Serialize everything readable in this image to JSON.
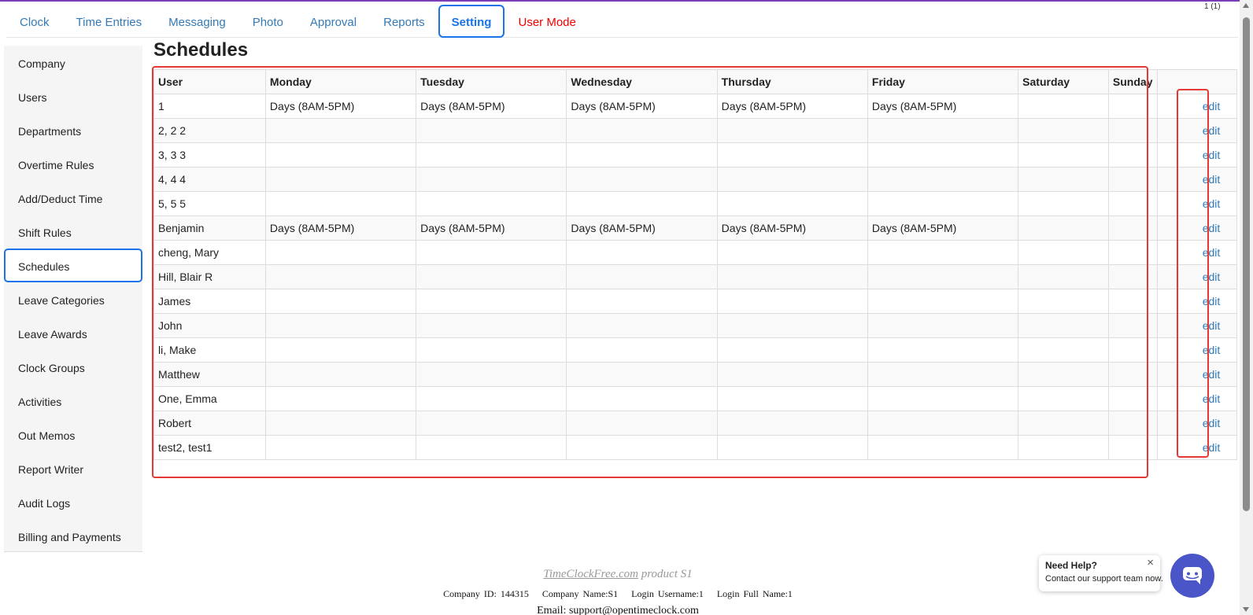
{
  "page_counter": "1 (1)",
  "topnav": {
    "tabs": [
      {
        "label": "Clock",
        "state": "normal"
      },
      {
        "label": "Time Entries",
        "state": "normal"
      },
      {
        "label": "Messaging",
        "state": "normal"
      },
      {
        "label": "Photo",
        "state": "normal"
      },
      {
        "label": "Approval",
        "state": "normal"
      },
      {
        "label": "Reports",
        "state": "normal"
      },
      {
        "label": "Setting",
        "state": "active"
      },
      {
        "label": "User Mode",
        "state": "alert"
      }
    ]
  },
  "sidebar": {
    "items": [
      {
        "label": "Company"
      },
      {
        "label": "Users"
      },
      {
        "label": "Departments"
      },
      {
        "label": "Overtime Rules"
      },
      {
        "label": "Add/Deduct Time"
      },
      {
        "label": "Shift Rules"
      },
      {
        "label": "Schedules",
        "active": true
      },
      {
        "label": "Leave Categories"
      },
      {
        "label": "Leave Awards"
      },
      {
        "label": "Clock Groups"
      },
      {
        "label": "Activities"
      },
      {
        "label": "Out Memos"
      },
      {
        "label": "Report Writer"
      },
      {
        "label": "Audit Logs"
      },
      {
        "label": "Billing and Payments"
      }
    ]
  },
  "main": {
    "title": "Schedules",
    "table": {
      "columns": [
        "User",
        "Monday",
        "Tuesday",
        "Wednesday",
        "Thursday",
        "Friday",
        "Saturday",
        "Sunday",
        "",
        ""
      ],
      "edit_label": "edit",
      "rows": [
        {
          "user": "1",
          "days": [
            "Days (8AM-5PM)",
            "Days (8AM-5PM)",
            "Days (8AM-5PM)",
            "Days (8AM-5PM)",
            "Days (8AM-5PM)",
            "",
            ""
          ]
        },
        {
          "user": "2, 2 2",
          "days": [
            "",
            "",
            "",
            "",
            "",
            "",
            ""
          ]
        },
        {
          "user": "3, 3 3",
          "days": [
            "",
            "",
            "",
            "",
            "",
            "",
            ""
          ]
        },
        {
          "user": "4, 4 4",
          "days": [
            "",
            "",
            "",
            "",
            "",
            "",
            ""
          ]
        },
        {
          "user": "5, 5 5",
          "days": [
            "",
            "",
            "",
            "",
            "",
            "",
            ""
          ]
        },
        {
          "user": "Benjamin",
          "days": [
            "Days (8AM-5PM)",
            "Days (8AM-5PM)",
            "Days (8AM-5PM)",
            "Days (8AM-5PM)",
            "Days (8AM-5PM)",
            "",
            ""
          ]
        },
        {
          "user": "cheng, Mary",
          "days": [
            "",
            "",
            "",
            "",
            "",
            "",
            ""
          ]
        },
        {
          "user": "Hill, Blair R",
          "days": [
            "",
            "",
            "",
            "",
            "",
            "",
            ""
          ]
        },
        {
          "user": "James",
          "days": [
            "",
            "",
            "",
            "",
            "",
            "",
            ""
          ]
        },
        {
          "user": "John",
          "days": [
            "",
            "",
            "",
            "",
            "",
            "",
            ""
          ]
        },
        {
          "user": "li, Make",
          "days": [
            "",
            "",
            "",
            "",
            "",
            "",
            ""
          ]
        },
        {
          "user": "Matthew",
          "days": [
            "",
            "",
            "",
            "",
            "",
            "",
            ""
          ]
        },
        {
          "user": "One, Emma",
          "days": [
            "",
            "",
            "",
            "",
            "",
            "",
            ""
          ]
        },
        {
          "user": "Robert",
          "days": [
            "",
            "",
            "",
            "",
            "",
            "",
            ""
          ]
        },
        {
          "user": "test2, test1",
          "days": [
            "",
            "",
            "",
            "",
            "",
            "",
            ""
          ]
        }
      ]
    }
  },
  "footer": {
    "brand_link": "TimeClockFree.com",
    "brand_suffix": " product S1",
    "company_id": "Company ID: 144315",
    "company_name": "Company Name:S1",
    "login_username": "Login Username:1",
    "login_full_name": "Login Full Name:1",
    "email": "Email: support@opentimeclock.com"
  },
  "help_widget": {
    "title": "Need Help?",
    "subtitle": "Contact our support team now.",
    "close_glyph": "×"
  },
  "colors": {
    "accent_blue": "#1a73e8",
    "link_blue": "#337ab7",
    "alert_red": "#e00000",
    "highlight_red": "#e53935",
    "chat_button": "#4a55c8"
  },
  "icons": {
    "close": "close-icon",
    "chat": "chat-support-icon"
  }
}
